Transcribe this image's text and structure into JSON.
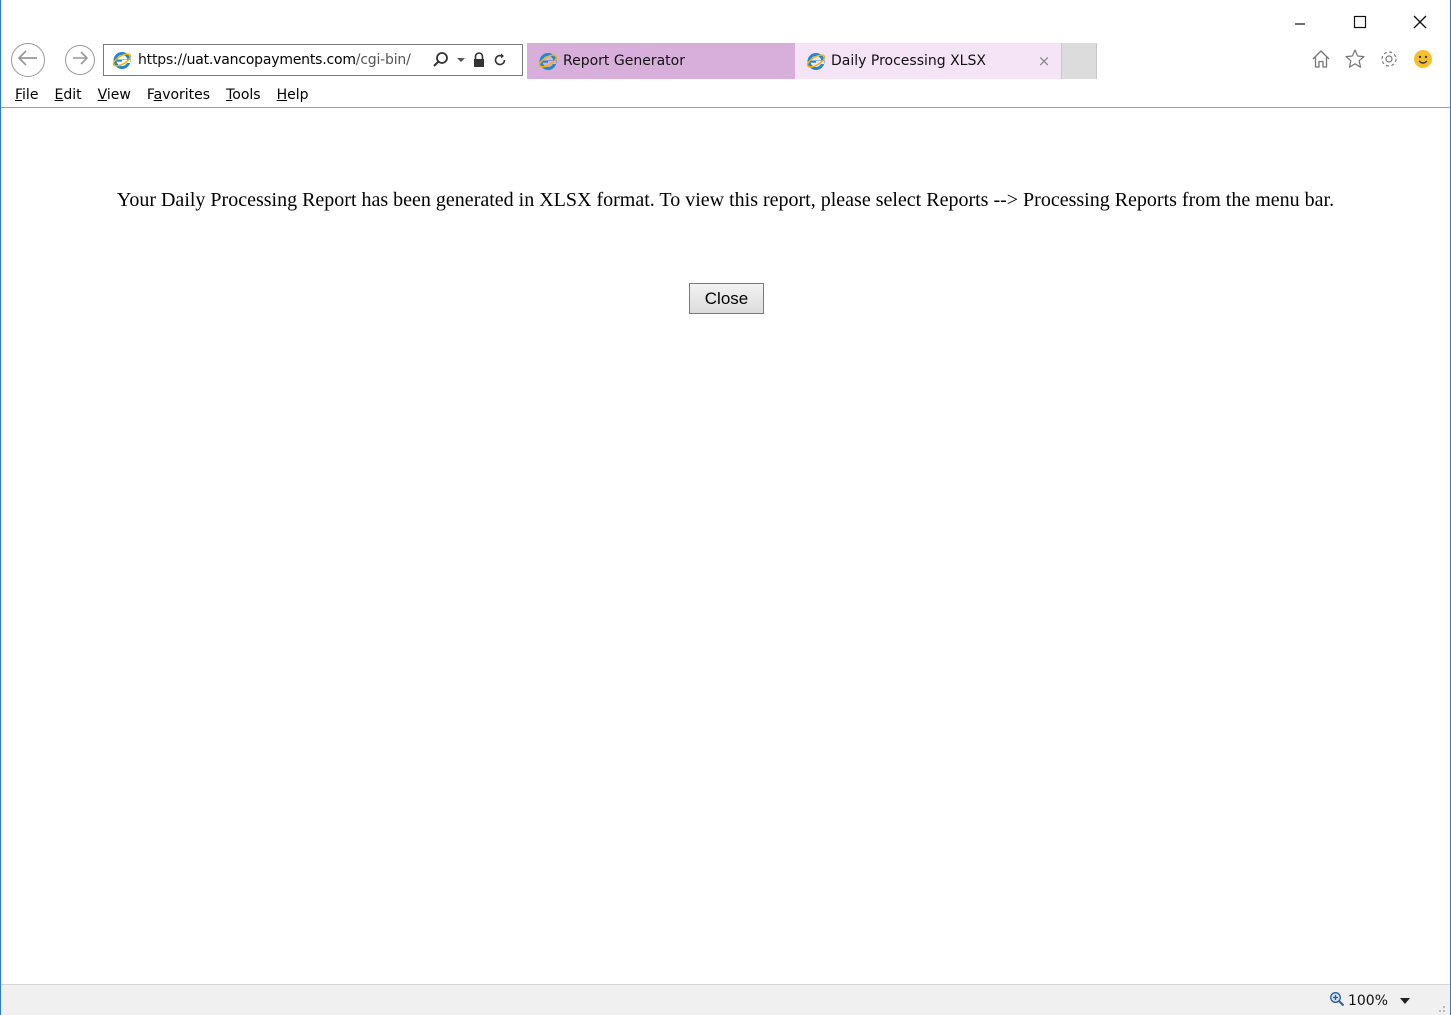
{
  "browser": {
    "address_url_scheme": "https://",
    "address_url_host": "uat.vancopayments.com",
    "address_url_path": "/cgi-bin/",
    "tabs": [
      {
        "label": "Report Generator",
        "active": false
      },
      {
        "label": "Daily Processing XLSX",
        "active": true,
        "close_glyph": "×"
      }
    ]
  },
  "menu": {
    "items": [
      {
        "label": "File",
        "accel": "F",
        "rest": "ile"
      },
      {
        "label": "Edit",
        "accel": "E",
        "rest": "dit"
      },
      {
        "label": "View",
        "accel": "V",
        "rest": "iew"
      },
      {
        "label": "Favorites",
        "pre": "F",
        "accel": "a",
        "rest": "vorites"
      },
      {
        "label": "Tools",
        "accel": "T",
        "rest": "ools"
      },
      {
        "label": "Help",
        "accel": "H",
        "rest": "elp"
      }
    ]
  },
  "page": {
    "message": "Your Daily Processing Report has been generated in XLSX format. To view this report, please select Reports --> Processing Reports from the menu bar.",
    "close_button_label": "Close"
  },
  "status": {
    "zoom_label": "100%"
  },
  "icons": [
    "minimize-icon",
    "maximize-icon",
    "close-window-icon",
    "back-icon",
    "forward-icon",
    "ie-logo-icon",
    "search-icon",
    "dropdown-icon",
    "lock-icon",
    "refresh-icon",
    "home-icon",
    "favorites-star-icon",
    "settings-gear-icon",
    "feedback-smiley-icon",
    "zoom-icon",
    "resize-grip-icon"
  ],
  "colors": {
    "window_border": "#2b7bd0",
    "tab_inactive": "#d8aedb",
    "tab_active": "#f5e4f5",
    "ie_blue": "#1e88d6",
    "smiley": "#f6c02a"
  }
}
